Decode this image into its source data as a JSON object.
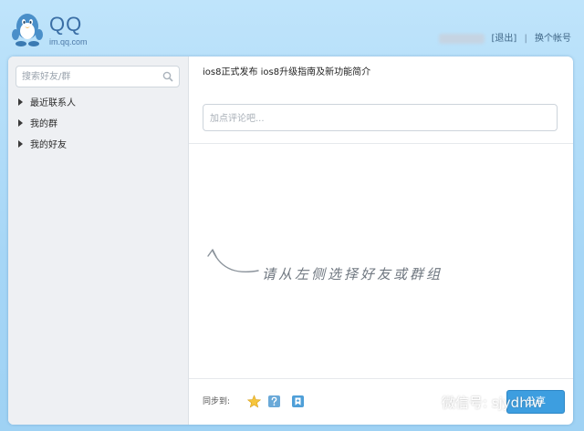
{
  "header": {
    "logo_title": "QQ",
    "logo_subtitle": "im.qq.com",
    "logout_label": "[退出]",
    "separator": "|",
    "switch_account_label": "换个帐号"
  },
  "sidebar": {
    "search_placeholder": "搜索好友/群",
    "items": [
      {
        "label": "最近联系人"
      },
      {
        "label": "我的群"
      },
      {
        "label": "我的好友"
      }
    ]
  },
  "main": {
    "post_title": "ios8正式发布 ios8升级指南及新功能简介",
    "comment_placeholder": "加点评论吧...",
    "hint": "请从左侧选择好友或群组",
    "sync_label": "同步到:",
    "send_label": "分享"
  },
  "watermark": {
    "text": "微信号: sjydhlw"
  },
  "colors": {
    "background": "#a6d6f6",
    "brand_blue": "#3a6ea5",
    "send_button": "#3d9ee0"
  },
  "icons": {
    "logo": "qq-penguin-icon",
    "search": "search-icon",
    "sync": [
      "star-icon",
      "question-icon",
      "bookmark-icon"
    ],
    "hint_arrow": "curved-arrow-icon",
    "watermark": "wechat-icon"
  }
}
